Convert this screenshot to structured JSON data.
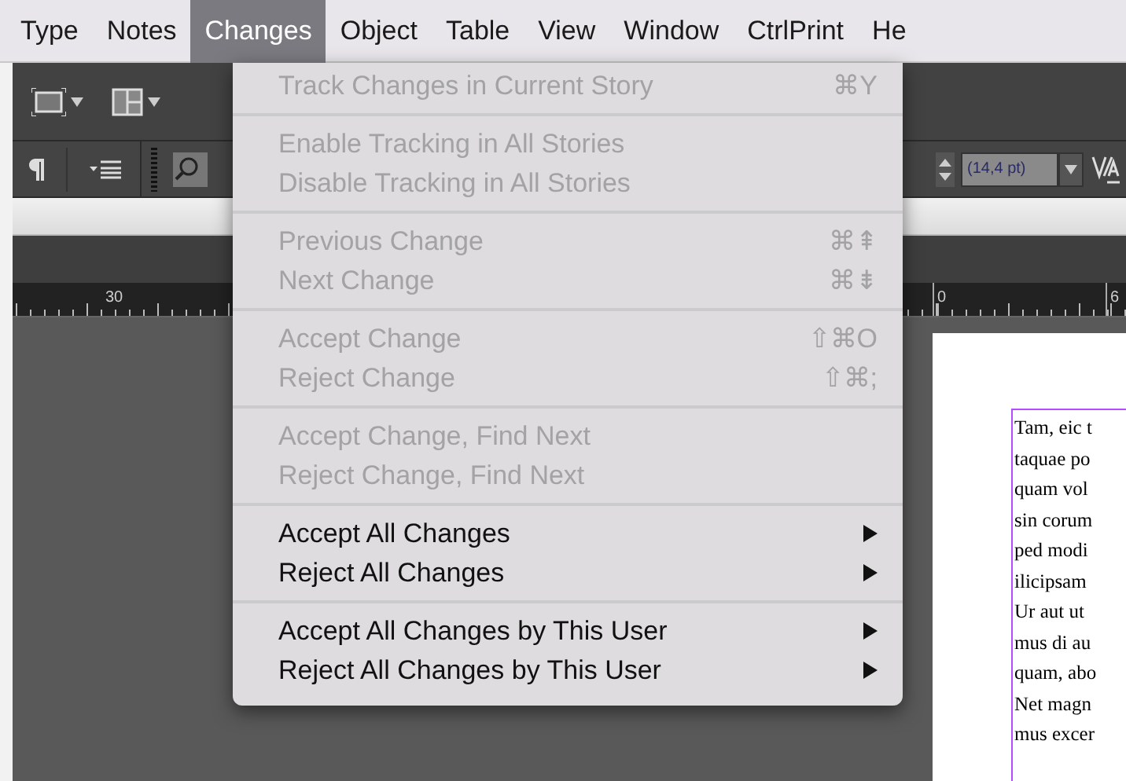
{
  "menu_bar": [
    {
      "label": "Type",
      "selected": false
    },
    {
      "label": "Notes",
      "selected": false
    },
    {
      "label": "Changes",
      "selected": true
    },
    {
      "label": "Object",
      "selected": false
    },
    {
      "label": "Table",
      "selected": false
    },
    {
      "label": "View",
      "selected": false
    },
    {
      "label": "Window",
      "selected": false
    },
    {
      "label": "CtrlPrint",
      "selected": false
    },
    {
      "label": "He",
      "selected": false
    }
  ],
  "changes_menu": [
    [
      {
        "label": "Track Changes in Current Story",
        "shortcut": "⌘Y",
        "disabled": true,
        "submenu": false
      }
    ],
    [
      {
        "label": "Enable Tracking in All Stories",
        "disabled": true,
        "submenu": false
      },
      {
        "label": "Disable Tracking in All Stories",
        "disabled": true,
        "submenu": false
      }
    ],
    [
      {
        "label": "Previous Change",
        "shortcut": "⌘⇞",
        "disabled": true,
        "submenu": false
      },
      {
        "label": "Next Change",
        "shortcut": "⌘⇟",
        "disabled": true,
        "submenu": false
      }
    ],
    [
      {
        "label": "Accept Change",
        "shortcut": "⇧⌘O",
        "disabled": true,
        "submenu": false
      },
      {
        "label": "Reject Change",
        "shortcut": "⇧⌘;",
        "disabled": true,
        "submenu": false
      }
    ],
    [
      {
        "label": "Accept Change, Find Next",
        "disabled": true,
        "submenu": false
      },
      {
        "label": "Reject Change, Find Next",
        "disabled": true,
        "submenu": false
      }
    ],
    [
      {
        "label": "Accept All Changes",
        "disabled": false,
        "submenu": true
      },
      {
        "label": "Reject All Changes",
        "disabled": false,
        "submenu": true
      }
    ],
    [
      {
        "label": "Accept All Changes by This User",
        "disabled": false,
        "submenu": true
      },
      {
        "label": "Reject All Changes by This User",
        "disabled": false,
        "submenu": true
      }
    ]
  ],
  "toolbar": {
    "leading_field": "(14,4 pt)"
  },
  "ruler": {
    "left_label": "30",
    "right_labels": [
      "0",
      "6"
    ]
  },
  "story_text": [
    "Tam, eic t",
    "taquae po",
    "quam vol",
    "sin corum",
    "ped modi",
    "ilicipsam",
    "Ur aut ut",
    "mus di au",
    "quam, abo",
    "Net magn",
    "mus excer"
  ]
}
